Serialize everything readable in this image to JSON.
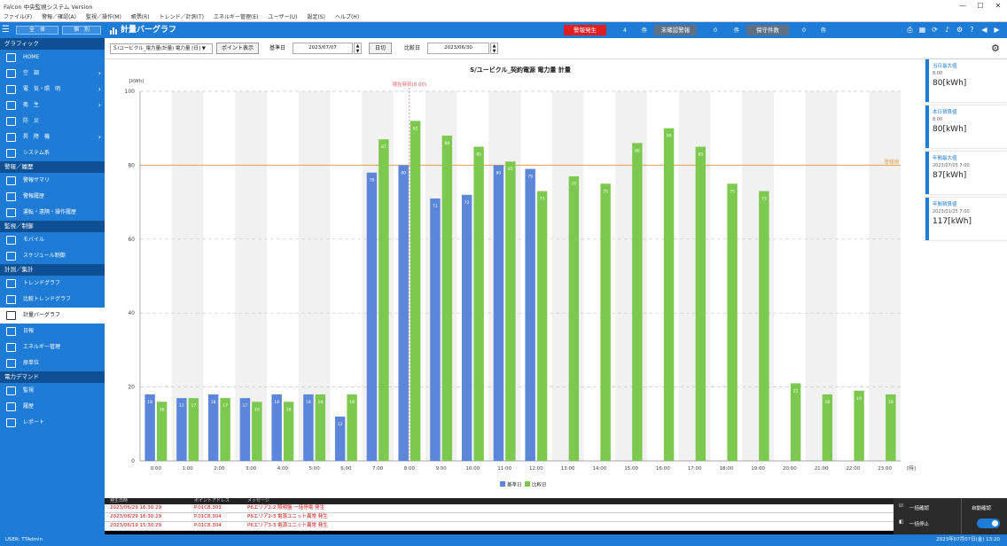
{
  "title_bar": {
    "title": "Falcon 中央監視システム Version",
    "min": "—",
    "max": "☐",
    "close": "✕"
  },
  "menu": [
    "ファイル(F)",
    "警報／確認(A)",
    "監視／操作(M)",
    "帳票(R)",
    "トレンド／計測(T)",
    "エネルギー管理(E)",
    "ユーザー(U)",
    "設定(S)",
    "ヘルプ(H)"
  ],
  "top": {
    "tab_a": "全　体",
    "tab_b": "個　別",
    "page_title": "計量バーグラフ",
    "alarm1_label": "警報発生",
    "alarm1_count": "4",
    "alarm1_unit": "件",
    "alarm2_label": "未確認警報",
    "alarm2_count": "0",
    "alarm2_unit": "件",
    "alarm3_label": "保守件数",
    "alarm3_count": "0",
    "alarm3_unit": "件",
    "icons": [
      "printer-icon",
      "layout-icon",
      "refresh-icon",
      "speaker-icon",
      "gear-icon",
      "help-icon",
      "back-icon",
      "forward-icon"
    ]
  },
  "sidebar": {
    "sections": [
      {
        "title": "グラフィック",
        "items": [
          {
            "label": "HOME",
            "icon": "monitor-icon",
            "chevron": ""
          },
          {
            "label": "空　調",
            "icon": "fan-icon",
            "chevron": "›"
          },
          {
            "label": "電　気・照　明",
            "icon": "lightning-icon",
            "chevron": "›"
          },
          {
            "label": "衛　生",
            "icon": "water-icon",
            "chevron": "›"
          },
          {
            "label": "防　災",
            "icon": "fire-icon",
            "chevron": ""
          },
          {
            "label": "昇　降　機",
            "icon": "lamp-icon",
            "chevron": "›"
          },
          {
            "label": "システム系",
            "icon": "list-icon",
            "chevron": ""
          }
        ]
      },
      {
        "title": "警報／履歴",
        "items": [
          {
            "label": "警報サマリ",
            "icon": "alert-icon",
            "chevron": ""
          },
          {
            "label": "警報履歴",
            "icon": "history-icon",
            "chevron": ""
          },
          {
            "label": "運転・遠隔・操作履歴",
            "icon": "list-icon",
            "chevron": ""
          }
        ]
      },
      {
        "title": "監視／制御",
        "items": [
          {
            "label": "モバイル",
            "icon": "list-icon",
            "chevron": ""
          },
          {
            "label": "スケジュール制御",
            "icon": "calendar-icon",
            "chevron": ""
          }
        ]
      },
      {
        "title": "計測／集計",
        "items": [
          {
            "label": "トレンドグラフ",
            "icon": "trend-icon",
            "chevron": ""
          },
          {
            "label": "比較トレンドグラフ",
            "icon": "compare-icon",
            "chevron": ""
          },
          {
            "label": "計量バーグラフ",
            "icon": "bar-chart-icon",
            "chevron": "",
            "active": true
          },
          {
            "label": "日報",
            "icon": "report-icon",
            "chevron": ""
          },
          {
            "label": "エネルギー管理",
            "icon": "leaf-icon",
            "chevron": ""
          },
          {
            "label": "原単位",
            "icon": "calc-icon",
            "chevron": ""
          }
        ]
      },
      {
        "title": "電力デマンド",
        "items": [
          {
            "label": "監視",
            "icon": "graph-icon",
            "chevron": ""
          },
          {
            "label": "履歴",
            "icon": "bar-chart-icon",
            "chevron": ""
          },
          {
            "label": "レポート",
            "icon": "document-icon",
            "chevron": ""
          }
        ]
      }
    ]
  },
  "toolbar": {
    "point_select": "Ｓ/ユービクル_電力量(計量) 電力量 [日] ▼",
    "point_button": "ポイント表示",
    "base_date_label": "基準日",
    "base_date": "2023/07/07",
    "unit_button": "日切",
    "compare_label": "比較日",
    "compare_date": "2023/06/30"
  },
  "chart_data": {
    "type": "bar",
    "title": "S/ユービクル_契約電源 電力量 計量",
    "ylabel": "[kWh]",
    "xlabel": "[時]",
    "ylim": [
      0,
      100
    ],
    "yticks": [
      0,
      20,
      40,
      60,
      80,
      100
    ],
    "categories": [
      "0:00",
      "1:00",
      "2:00",
      "3:00",
      "4:00",
      "5:00",
      "6:00",
      "7:00",
      "8:00",
      "9:00",
      "10:00",
      "11:00",
      "12:00",
      "13:00",
      "14:00",
      "15:00",
      "16:00",
      "17:00",
      "18:00",
      "19:00",
      "20:00",
      "21:00",
      "22:00",
      "23:00"
    ],
    "series": [
      {
        "name": "基準日",
        "color": "#5b86d9",
        "values": [
          18,
          17,
          18,
          17,
          18,
          18,
          12,
          78,
          80,
          71,
          72,
          80,
          79,
          null,
          null,
          null,
          null,
          null,
          null,
          null,
          null,
          null,
          null,
          null
        ]
      },
      {
        "name": "比較日",
        "color": "#7dc94f",
        "values": [
          16,
          17,
          17,
          16,
          16,
          18,
          18,
          87,
          92,
          88,
          85,
          81,
          73,
          77,
          75,
          86,
          90,
          85,
          75,
          73,
          21,
          18,
          19,
          18
        ]
      }
    ],
    "threshold": {
      "value": 80,
      "label": "警報値",
      "color": "#e4a24a"
    },
    "marker": {
      "label": "現在時刻(8:00)",
      "x_index": 8,
      "color": "#e0606a"
    },
    "grid": true,
    "legend": "bottom"
  },
  "cards": [
    {
      "title": "当日最大値",
      "sub": "8:00",
      "value": "80[kWh]"
    },
    {
      "title": "本日積算値",
      "sub": "8:00",
      "value": "80[kWh]"
    },
    {
      "title": "年間最大値",
      "sub": "2023/07/05 7:00",
      "value": "87[kWh]"
    },
    {
      "title": "年間積算値",
      "sub": "2023/01/25 7:00",
      "value": "117[kWh]"
    }
  ],
  "messages": {
    "headers": [
      "発生日時",
      "ポイントアドレス",
      "メッセージ"
    ],
    "rows": [
      [
        "2023/06/29 16:30:29",
        "P.01C8.303",
        "P6エリア2-2 照明盤 一括停電 発生"
      ],
      [
        "2023/06/29 16:30:29",
        "P.01C8.304",
        "P6エリア2-3 電源ユニット異常 発生"
      ],
      [
        "2023/06/19 15:30:29",
        "P.01C8.304",
        "P6エリア3-3 電源ユニット異常 発生"
      ]
    ]
  },
  "alarm_panel": {
    "label1": "一括確認",
    "label2": "一括停止",
    "label3": "自動確認"
  },
  "status": {
    "user": "USER: TTAdmin",
    "datetime": "2023年07月07日(金)  13:20"
  }
}
